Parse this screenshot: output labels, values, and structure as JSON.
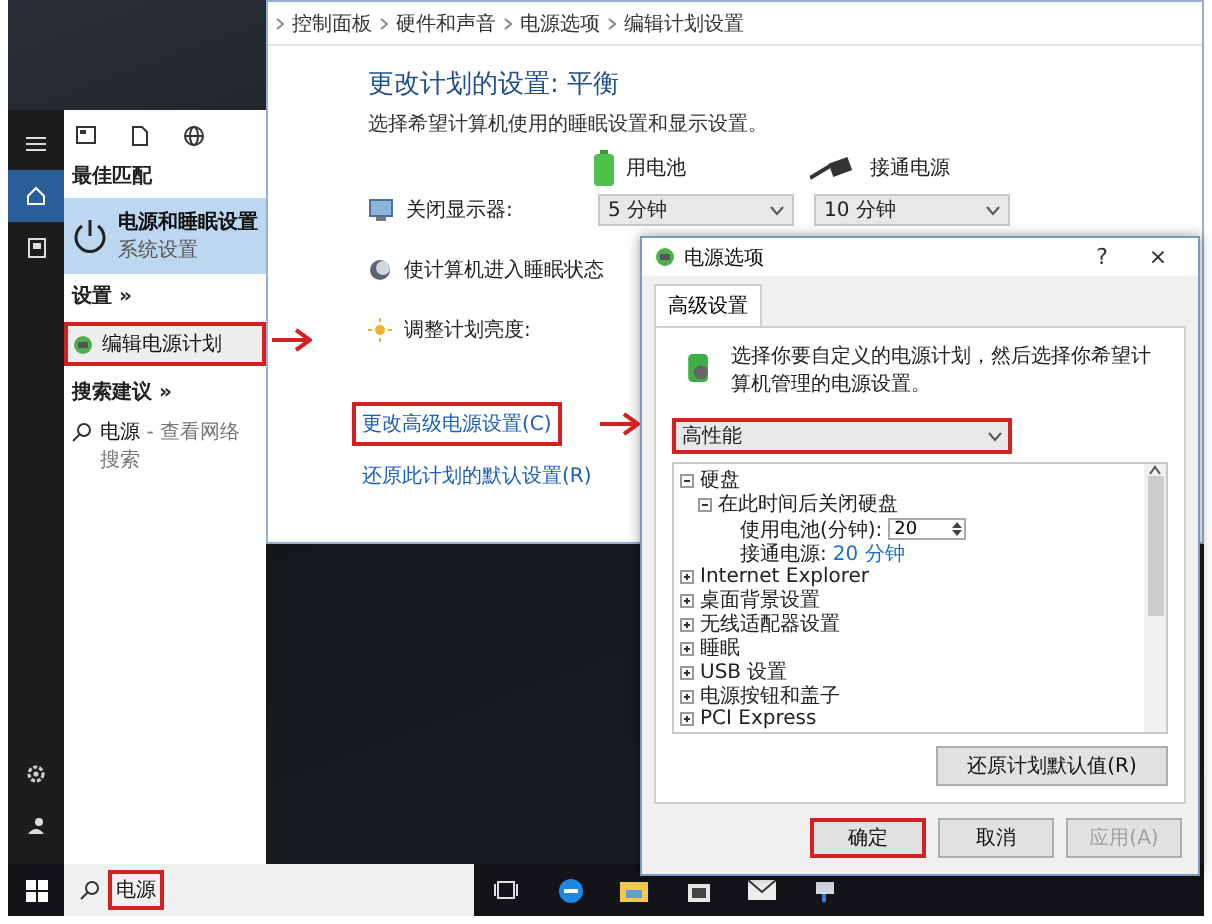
{
  "start_menu": {
    "section_best": "最佳匹配",
    "best_match": {
      "title": "电源和睡眠设置",
      "subtitle": "系统设置",
      "selected": true
    },
    "section_settings": "设置 »",
    "settings_items": [
      {
        "label": "编辑电源计划",
        "highlighted": true
      }
    ],
    "section_suggestions": "搜索建议 »",
    "suggestions": [
      {
        "label": "电源",
        "hint": "- 查看网络搜索"
      }
    ]
  },
  "search": {
    "value": "电源",
    "highlighted": true
  },
  "control_panel": {
    "breadcrumb": [
      "控制面板",
      "硬件和声音",
      "电源选项",
      "编辑计划设置"
    ],
    "title": "更改计划的设置: 平衡",
    "subtitle": "选择希望计算机使用的睡眠设置和显示设置。",
    "columns": [
      "用电池",
      "接通电源"
    ],
    "rows": [
      {
        "kind": "dropdowns",
        "label": "关闭显示器:",
        "values": [
          "5 分钟",
          "10 分钟"
        ]
      },
      {
        "kind": "plain",
        "label": "使计算机进入睡眠状态"
      },
      {
        "kind": "plain",
        "label": "调整计划亮度:"
      }
    ],
    "links": [
      {
        "label": "更改高级电源设置(C)",
        "highlighted": true
      },
      {
        "label": "还原此计划的默认设置(R)",
        "highlighted": false
      }
    ]
  },
  "dialog": {
    "title": "电源选项",
    "help": "?",
    "close": "×",
    "tabs": [
      {
        "label": "高级设置",
        "selected": true
      }
    ],
    "description": "选择你要自定义的电源计划，然后选择你希望计算机管理的电源设置。",
    "plan": {
      "value": "高性能",
      "highlighted": true
    },
    "tree": [
      {
        "kind": "group",
        "label": "硬盘",
        "expanded": true,
        "children": [
          {
            "kind": "group",
            "label": "在此时间后关闭硬盘",
            "expanded": true,
            "children": [
              {
                "kind": "spin",
                "label": "使用电池(分钟):",
                "value": "20"
              },
              {
                "kind": "value",
                "label": "接通电源:",
                "value": "20 分钟"
              }
            ]
          }
        ]
      },
      {
        "kind": "group",
        "label": "Internet Explorer",
        "expanded": false
      },
      {
        "kind": "group",
        "label": "桌面背景设置",
        "expanded": false
      },
      {
        "kind": "group",
        "label": "无线适配器设置",
        "expanded": false
      },
      {
        "kind": "group",
        "label": "睡眠",
        "expanded": false
      },
      {
        "kind": "group",
        "label": "USB 设置",
        "expanded": false
      },
      {
        "kind": "group",
        "label": "电源按钮和盖子",
        "expanded": false
      },
      {
        "kind": "group",
        "label": "PCI Express",
        "expanded": false
      }
    ],
    "restore_button": "还原计划默认值(R)",
    "buttons": [
      {
        "label": "确定",
        "highlighted": true,
        "disabled": false
      },
      {
        "label": "取消",
        "highlighted": false,
        "disabled": false
      },
      {
        "label": "应用(A)",
        "highlighted": false,
        "disabled": true
      }
    ]
  }
}
